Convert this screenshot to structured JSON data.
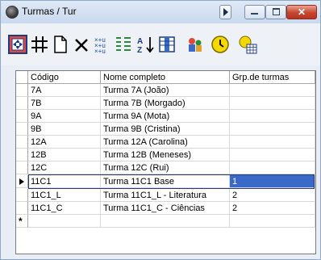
{
  "window": {
    "title": "Turmas / Tur"
  },
  "toolbar": {
    "icons": [
      "move-icon",
      "grid-icon",
      "new-document-icon",
      "delete-icon",
      "shuffle-icon",
      "sort-az-icon",
      "columns-icon",
      "people-icon",
      "clock-icon",
      "schedule-icon"
    ]
  },
  "table": {
    "headers": {
      "code": "Código",
      "name": "Nome completo",
      "group": "Grp.de turmas"
    },
    "rows": [
      {
        "code": "7A",
        "name": "Turma 7A (João)",
        "group": ""
      },
      {
        "code": "7B",
        "name": "Turma 7B (Morgado)",
        "group": ""
      },
      {
        "code": "9A",
        "name": "Turma 9A (Mota)",
        "group": ""
      },
      {
        "code": "9B",
        "name": "Turma 9B (Cristina)",
        "group": ""
      },
      {
        "code": "12A",
        "name": "Turma 12A (Carolina)",
        "group": ""
      },
      {
        "code": "12B",
        "name": "Turma 12B (Meneses)",
        "group": ""
      },
      {
        "code": "12C",
        "name": "Turma 12C (Rui)",
        "group": ""
      },
      {
        "code": "11C1",
        "name": "Turma 11C1 Base",
        "group": "1"
      },
      {
        "code": "11C1_L",
        "name": "Turma 11C1_L - Literatura",
        "group": "2"
      },
      {
        "code": "11C1_C",
        "name": "Turma 11C1_C - Ciências",
        "group": "2"
      }
    ],
    "new_row_marker": "*"
  }
}
